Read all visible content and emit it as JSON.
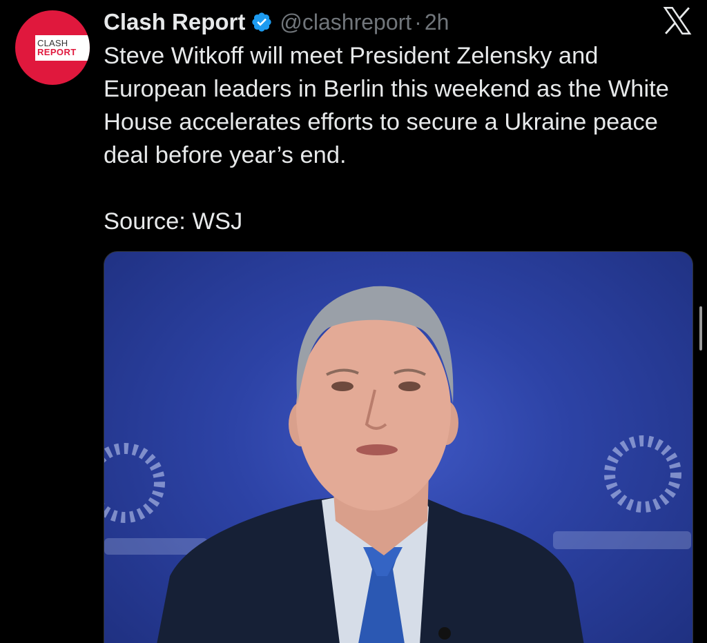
{
  "author": {
    "display_name": "Clash Report",
    "handle": "@clashreport",
    "separator": "·",
    "time": "2h",
    "verified": true,
    "avatar": {
      "line1": "CLASH",
      "line2": "REPORT",
      "background_color": "#e0183d"
    }
  },
  "tweet": {
    "text": "Steve Witkoff will meet President Zelensky and European leaders in Berlin this weekend as the White House accelerates efforts to secure a Ukraine peace deal before year’s end.",
    "source": "Source: WSJ"
  },
  "icons": {
    "verified": "verified-badge-icon",
    "close": "x-logo-icon"
  },
  "colors": {
    "background": "#000000",
    "text": "#e7e9ea",
    "muted": "#71767b",
    "verified": "#1d9bf0",
    "brand_red": "#e0183d",
    "photo_backdrop": "#2d43a6"
  }
}
